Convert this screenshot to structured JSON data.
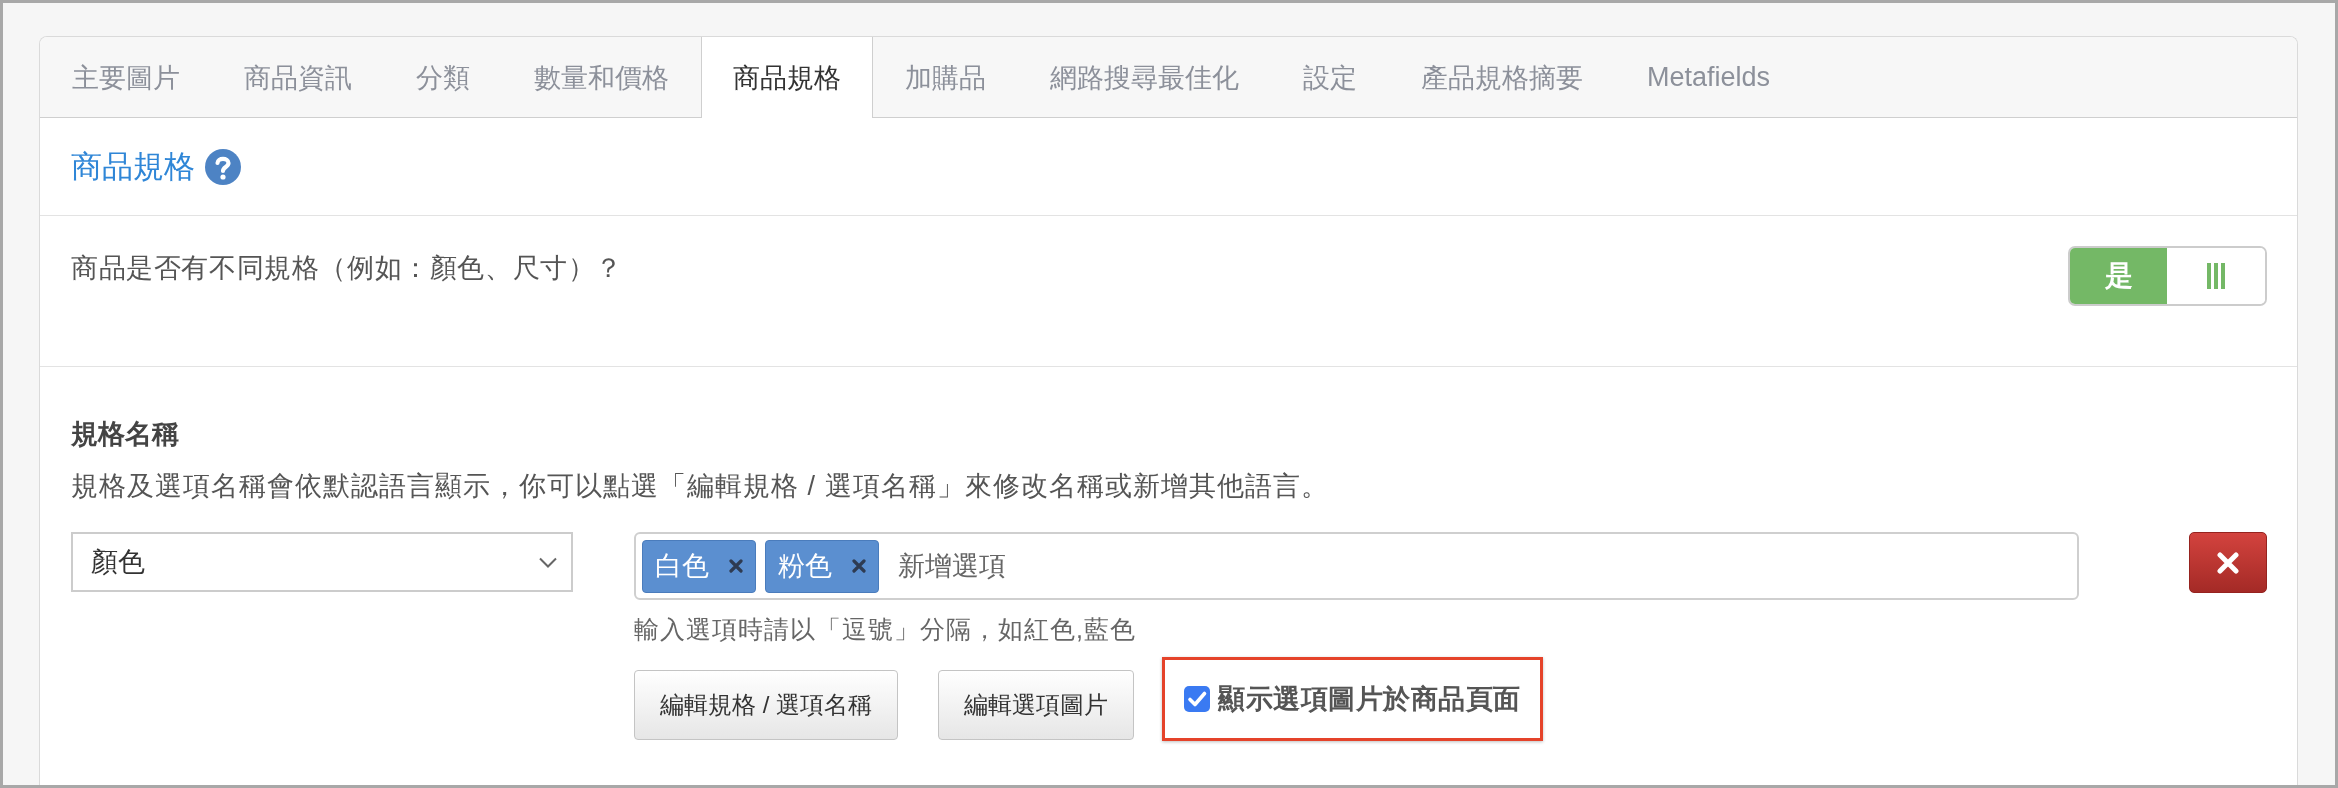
{
  "tabs": [
    {
      "label": "主要圖片",
      "selected": false
    },
    {
      "label": "商品資訊",
      "selected": false
    },
    {
      "label": "分類",
      "selected": false
    },
    {
      "label": "數量和價格",
      "selected": false
    },
    {
      "label": "商品規格",
      "selected": true
    },
    {
      "label": "加購品",
      "selected": false
    },
    {
      "label": "網路搜尋最佳化",
      "selected": false
    },
    {
      "label": "設定",
      "selected": false
    },
    {
      "label": "產品規格摘要",
      "selected": false
    },
    {
      "label": "Metafields",
      "selected": false
    }
  ],
  "section": {
    "title": "商品規格"
  },
  "variants": {
    "question": "商品是否有不同規格（例如：顏色、尺寸）？",
    "toggle": {
      "on": true,
      "on_label": "是"
    }
  },
  "spec": {
    "heading": "規格名稱",
    "description": "規格及選項名稱會依默認語言顯示，你可以點選「編輯規格 / 選項名稱」來修改名稱或新增其他語言。",
    "option_name": "顏色",
    "option_input": {
      "tags": [
        "白色",
        "粉色"
      ],
      "placeholder": "新增選項"
    },
    "hint": "輸入選項時請以「逗號」分隔，如紅色,藍色",
    "buttons": [
      "編輯規格 / 選項名稱",
      "編輯選項圖片"
    ],
    "show_images": {
      "label": "顯示選項圖片於商品頁面",
      "checked": true,
      "highlighted": true
    }
  }
}
